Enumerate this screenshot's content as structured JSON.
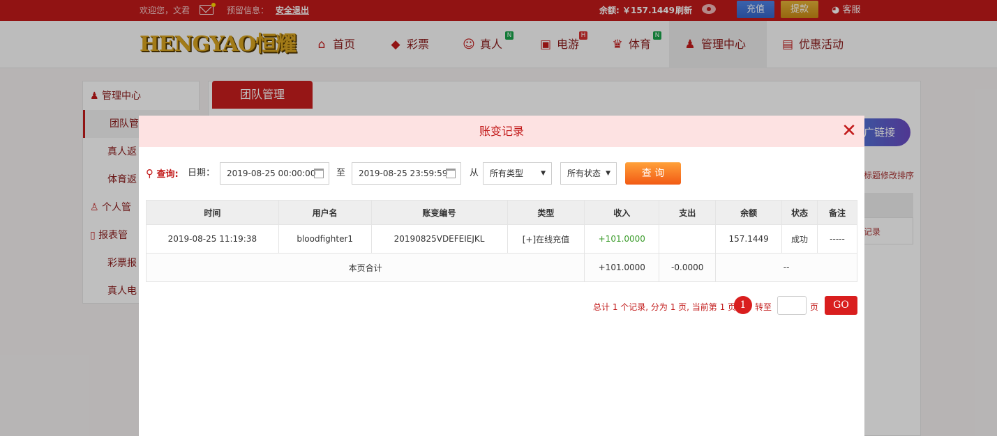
{
  "topbar": {
    "welcome": "欢迎您，文君",
    "reserve": "预留信息：",
    "logout": "安全退出",
    "balance": "余额: ￥157.1449",
    "refresh": "刷新",
    "recharge": "充值",
    "withdraw": "提款",
    "service": "客服"
  },
  "nav": {
    "logo": "HENGYAO恒耀",
    "items": [
      {
        "label": "首页",
        "icon": "home-icon"
      },
      {
        "label": "彩票",
        "icon": "ticket-icon"
      },
      {
        "label": "真人",
        "icon": "person-icon",
        "badge": "N"
      },
      {
        "label": "电游",
        "icon": "slot-icon",
        "badge": "H"
      },
      {
        "label": "体育",
        "icon": "trophy-icon",
        "badge": "N"
      },
      {
        "label": "管理中心",
        "icon": "users-icon"
      },
      {
        "label": "优惠活动",
        "icon": "gift-icon"
      }
    ]
  },
  "sidebar": {
    "header": "管理中心",
    "items": [
      "团队管",
      "真人返",
      "体育返",
      "个人管",
      "报表管",
      "彩票报",
      "真人电"
    ]
  },
  "main": {
    "tab": "团队管理",
    "promo": "广链接",
    "hint1": "标题修改排序",
    "hint2": "记录"
  },
  "modal": {
    "title": "账变记录",
    "query_label": "查询:",
    "date_label": "日期：",
    "start_date": "2019-08-25 00:00:00",
    "to": "至",
    "end_date": "2019-08-25 23:59:59",
    "from": "从",
    "type_select": "所有类型",
    "status_select": "所有状态",
    "query_button": "查 询",
    "table": {
      "headers": [
        "时间",
        "用户名",
        "账变编号",
        "类型",
        "收入",
        "支出",
        "余额",
        "状态",
        "备注"
      ],
      "rows": [
        {
          "time": "2019-08-25 11:19:38",
          "user": "bloodfighter1",
          "id": "20190825VDEFEIEJKL",
          "type": "[+]在线充值",
          "income": "+101.0000",
          "expense": "",
          "balance": "157.1449",
          "status": "成功",
          "note": "-----"
        }
      ],
      "sum": {
        "label": "本页合计",
        "income": "+101.0000",
        "expense": "-0.0000",
        "rest": "--"
      }
    },
    "pager": {
      "summary": "总计 1 个记录, 分为 1 页, 当前第 1 页",
      "page": "1",
      "goto": "转至",
      "unit": "页",
      "go": "GO"
    }
  }
}
